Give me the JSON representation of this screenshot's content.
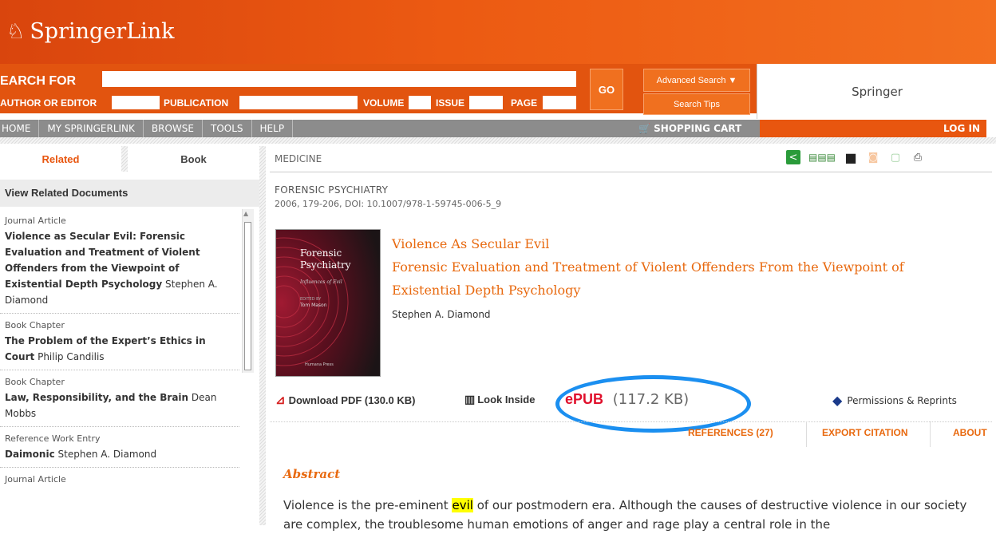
{
  "header": {
    "logo_text": "SpringerLink"
  },
  "search": {
    "search_for_label": "EARCH FOR",
    "author_label": "AUTHOR OR EDITOR",
    "publication_label": "PUBLICATION",
    "volume_label": "VOLUME",
    "issue_label": "ISSUE",
    "page_label": "PAGE",
    "go_label": "GO",
    "advanced_label": "Advanced Search ▼",
    "tips_label": "Search Tips"
  },
  "institution": "Springer",
  "nav": {
    "items": [
      "HOME",
      "MY SPRINGERLINK",
      "BROWSE",
      "TOOLS",
      "HELP"
    ],
    "cart": "SHOPPING CART",
    "login": "LOG IN"
  },
  "sidebar": {
    "tab_related": "Related",
    "tab_book": "Book",
    "header": "View Related Documents",
    "items": [
      {
        "type": "Journal Article",
        "title": "Violence as Secular Evil: Forensic Evaluation and Treatment of Violent Offenders from the Viewpoint of Existential Depth Psychology",
        "author": "Stephen A. Diamond"
      },
      {
        "type": "Book Chapter",
        "title": "The Problem of the Expert’s Ethics in Court",
        "author": "Philip Candilis"
      },
      {
        "type": "Book Chapter",
        "title": "Law, Responsibility, and the Brain",
        "author": "Dean Mobbs"
      },
      {
        "type": "Reference Work Entry",
        "title": "Daimonic",
        "author": "Stephen A. Diamond"
      },
      {
        "type": "Journal Article",
        "title": "",
        "author": ""
      }
    ]
  },
  "main": {
    "breadcrumb": "MEDICINE",
    "book_title": "FORENSIC PSYCHIATRY",
    "meta": "2006, 179-206, DOI: 10.1007/978-1-59745-006-5_9",
    "cover": {
      "title_line1": "Forensic",
      "title_line2": "Psychiatry",
      "subtitle": "Influences of Evil",
      "editor_label": "EDITED BY",
      "editor": "Tom Mason",
      "publisher": "Humana Press"
    },
    "title_line1": "Violence As Secular Evil",
    "title_line2": "Forensic Evaluation and Treatment of Violent Offenders From the Viewpoint of",
    "title_line3": "Existential Depth Psychology",
    "author": "Stephen A. Diamond",
    "download_pdf": "Download PDF (130.0 KB)",
    "look_inside": "Look Inside",
    "epub_label": "ePUB",
    "epub_size": "(117.2 KB)",
    "permissions": "Permissions & Reprints",
    "tabs": {
      "references": "REFERENCES (27)",
      "export": "EXPORT CITATION",
      "about": "ABOUT"
    },
    "abstract_title": "Abstract",
    "abstract_before": "Violence is the pre-eminent ",
    "abstract_highlight": "evil",
    "abstract_after": " of our postmodern era. Although the causes of destructive violence in our society are complex, the troublesome human emotions of anger and rage play a central role in the"
  },
  "colors": {
    "brand_orange": "#e8560f",
    "title_orange": "#e8690f",
    "highlight_circle": "#1b8ff0"
  }
}
